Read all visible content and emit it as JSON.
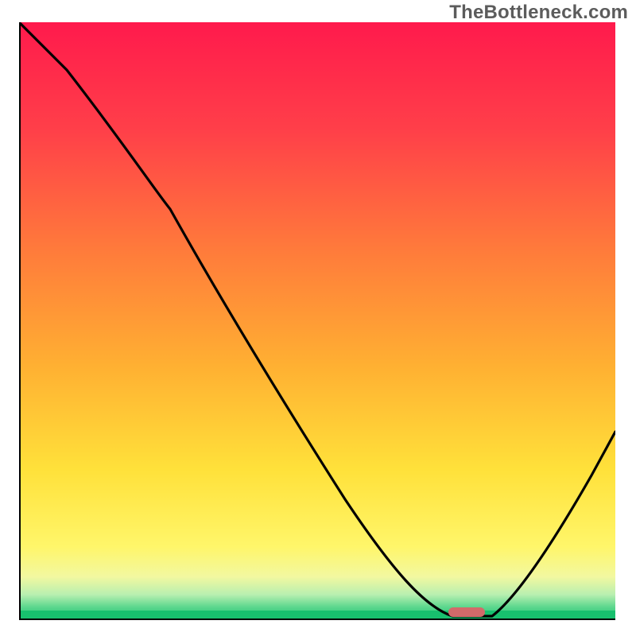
{
  "watermark": "TheBottleneck.com",
  "chart_data": {
    "type": "line",
    "title": "",
    "xlabel": "",
    "ylabel": "",
    "xlim": [
      0,
      100
    ],
    "ylim": [
      0,
      100
    ],
    "grid": false,
    "legend": null,
    "series": [
      {
        "name": "bottleneck-curve",
        "x": [
          0,
          8,
          25,
          45,
          60,
          70,
          73,
          79,
          85,
          92,
          100
        ],
        "y": [
          100,
          92,
          70,
          42,
          20,
          5,
          0,
          0,
          8,
          22,
          32
        ]
      }
    ],
    "annotations": [
      {
        "name": "optimal-marker",
        "x": 75,
        "y": 0
      }
    ],
    "background": {
      "type": "vertical-gradient",
      "stops": [
        {
          "pos": 0.0,
          "color": "#ff1a4c"
        },
        {
          "pos": 0.18,
          "color": "#ff3f49"
        },
        {
          "pos": 0.38,
          "color": "#ff7a3b"
        },
        {
          "pos": 0.58,
          "color": "#ffb132"
        },
        {
          "pos": 0.75,
          "color": "#ffe13a"
        },
        {
          "pos": 0.88,
          "color": "#fff66a"
        },
        {
          "pos": 0.93,
          "color": "#f2f8a0"
        },
        {
          "pos": 0.96,
          "color": "#b8efb0"
        },
        {
          "pos": 0.98,
          "color": "#5fd88f"
        },
        {
          "pos": 1.0,
          "color": "#1fc474"
        }
      ]
    }
  },
  "colors": {
    "curve": "#000000",
    "marker": "#d26a6a",
    "axis": "#000000",
    "watermark": "#5c5c5c"
  }
}
